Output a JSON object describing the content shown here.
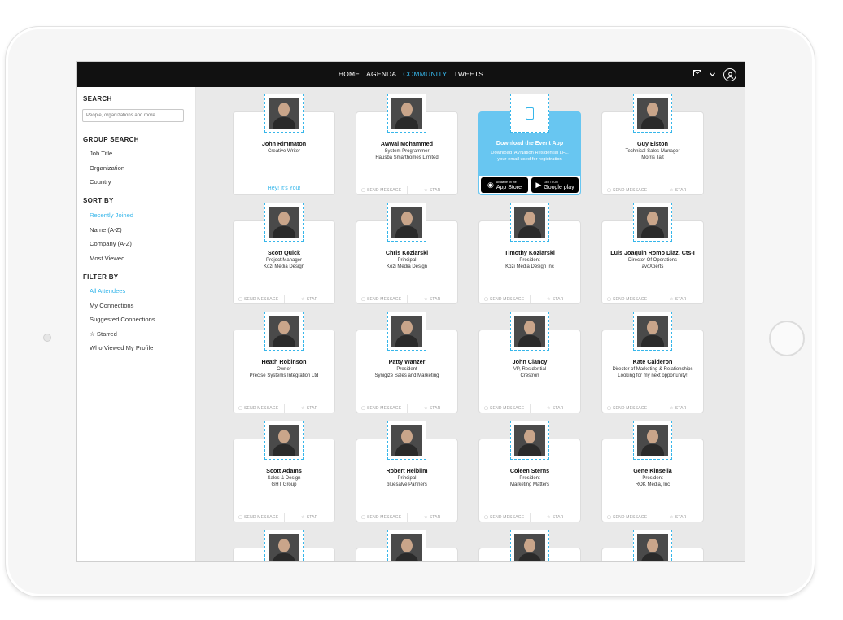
{
  "nav": {
    "links": [
      "HOME",
      "AGENDA",
      "COMMUNITY",
      "TWEETS"
    ],
    "active": "COMMUNITY",
    "icons": [
      "mail-icon",
      "chevron-down-icon",
      "user-avatar-icon"
    ]
  },
  "sidebar": {
    "search_heading": "SEARCH",
    "search_placeholder": "People, organizations and more...",
    "group_heading": "GROUP SEARCH",
    "group_items": [
      "Job Title",
      "Organization",
      "Country"
    ],
    "sort_heading": "SORT BY",
    "sort_items": [
      "Recently Joined",
      "Name (A-Z)",
      "Company (A-Z)",
      "Most Viewed"
    ],
    "sort_active": "Recently Joined",
    "filter_heading": "FILTER BY",
    "filter_items": [
      "All Attendees",
      "My Connections",
      "Suggested Connections",
      "☆ Starred",
      "Who Viewed My Profile"
    ],
    "filter_active": "All Attendees"
  },
  "actions": {
    "send_message": "SEND MESSAGE",
    "star": "STAR",
    "hey": "Hey! It's You!"
  },
  "promo": {
    "title": "Download the Event App",
    "line1": "Download 'AVNation Residential LF...",
    "line2": "your email used for registration",
    "app_store_small": "Available on the",
    "app_store_big": "App Store",
    "google_small": "GET IT ON",
    "google_big": "Google play"
  },
  "people": [
    {
      "name": "John Rimmaton",
      "title": "Creative Writer",
      "company": "",
      "self": true
    },
    {
      "name": "Awwal Mohammed",
      "title": "System Programmer",
      "company": "Hausba Smarthomes Limited"
    },
    {
      "promo": true
    },
    {
      "name": "Guy Elston",
      "title": "Technical Sales Manager",
      "company": "Morris Tait"
    },
    {
      "name": "Scott Quick",
      "title": "Project Manager",
      "company": "Kozi Media Design"
    },
    {
      "name": "Chris Koziarski",
      "title": "Principal",
      "company": "Kozi Media Design"
    },
    {
      "name": "Timothy Koziarski",
      "title": "President",
      "company": "Kozi Media Design Inc"
    },
    {
      "name": "Luis Joaquin Romo Diaz, Cts-I",
      "title": "Director Of Operations",
      "company": "avcXperts"
    },
    {
      "name": "Heath Robinson",
      "title": "Owner",
      "company": "Precise Systems Integration Ltd"
    },
    {
      "name": "Patty Wanzer",
      "title": "President",
      "company": "Synigize Sales and Marketing"
    },
    {
      "name": "John Clancy",
      "title": "VP, Residential",
      "company": "Crestron"
    },
    {
      "name": "Kate Calderon",
      "title": "Director of Marketing & Relationships",
      "company": "Looking for my next opportunity!"
    },
    {
      "name": "Scott Adams",
      "title": "Sales & Design",
      "company": "GHT Group"
    },
    {
      "name": "Robert Heiblim",
      "title": "Principal",
      "company": "bluesalve Partners"
    },
    {
      "name": "Coleen Sterns",
      "title": "President",
      "company": "Marketing Matters"
    },
    {
      "name": "Gene Kinsella",
      "title": "President",
      "company": "ROK Media, Inc"
    },
    {
      "name": "",
      "title": "",
      "company": ""
    },
    {
      "name": "",
      "title": "",
      "company": ""
    },
    {
      "name": "",
      "title": "",
      "company": ""
    },
    {
      "name": "",
      "title": "",
      "company": ""
    }
  ],
  "colors": {
    "accent": "#36b6ea",
    "promo_bg": "#68c6f1",
    "nav_bg": "#111111"
  }
}
